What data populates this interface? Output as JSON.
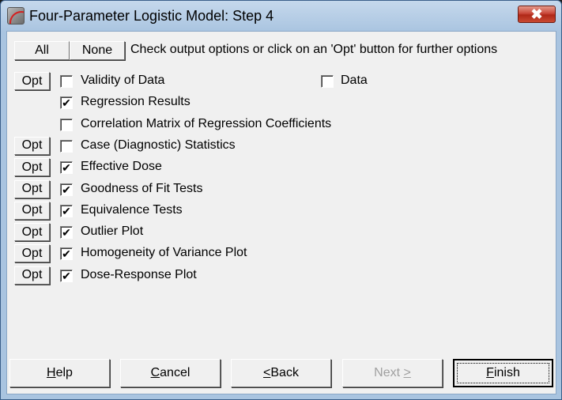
{
  "window": {
    "title": "Four-Parameter Logistic Model: Step 4",
    "close_label": "✖"
  },
  "toolbar": {
    "all_label": "All",
    "none_label": "None",
    "hint": "Check output options or click on an 'Opt' button for further options"
  },
  "opt_label": "Opt",
  "options": [
    {
      "label": "Validity of Data",
      "checked": false,
      "has_opt": true
    },
    {
      "label": "Regression Results",
      "checked": true,
      "has_opt": false
    },
    {
      "label": "Correlation Matrix of Regression Coefficients",
      "checked": false,
      "has_opt": false
    },
    {
      "label": "Case (Diagnostic) Statistics",
      "checked": false,
      "has_opt": true
    },
    {
      "label": "Effective Dose",
      "checked": true,
      "has_opt": true
    },
    {
      "label": "Goodness of Fit Tests",
      "checked": true,
      "has_opt": true
    },
    {
      "label": "Equivalence Tests",
      "checked": true,
      "has_opt": true
    },
    {
      "label": "Outlier Plot",
      "checked": true,
      "has_opt": true
    },
    {
      "label": "Homogeneity of Variance Plot",
      "checked": true,
      "has_opt": true
    },
    {
      "label": "Dose-Response Plot",
      "checked": true,
      "has_opt": true
    }
  ],
  "data_option": {
    "label": "Data",
    "checked": false
  },
  "buttons": {
    "help": {
      "pre": "",
      "accel": "H",
      "post": "elp"
    },
    "cancel": {
      "pre": "",
      "accel": "C",
      "post": "ancel"
    },
    "back": {
      "pre": "",
      "accel": "<",
      "post": " Back"
    },
    "next": {
      "pre": "Next ",
      "accel": ">",
      "post": "",
      "disabled": true
    },
    "finish": {
      "pre": "",
      "accel": "F",
      "post": "inish"
    }
  }
}
